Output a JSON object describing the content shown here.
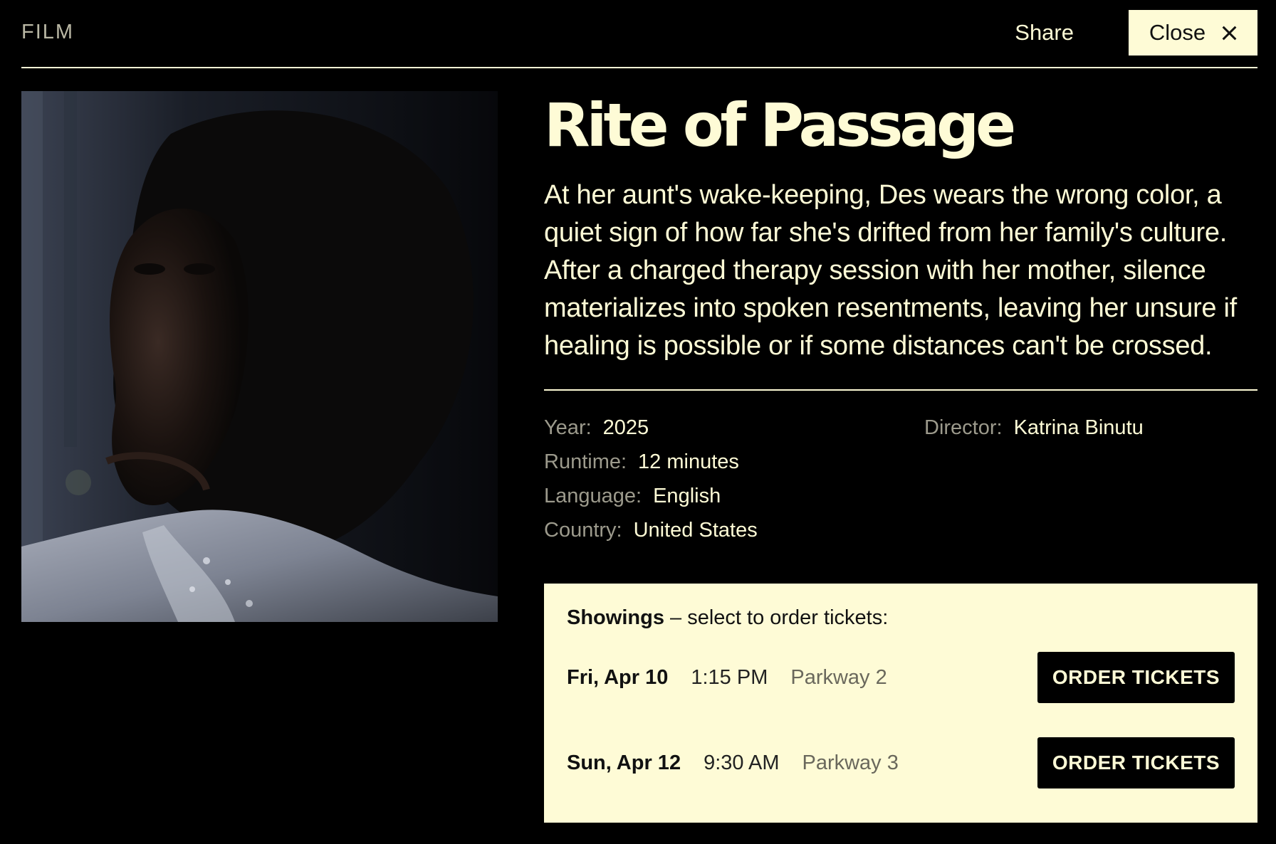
{
  "header": {
    "section_label": "FILM",
    "share_label": "Share",
    "close_label": "Close"
  },
  "film": {
    "title": "Rite of Passage",
    "synopsis": "At her aunt's wake-keeping, Des wears the wrong color, a quiet sign of how far she's drifted from her family's culture. After a charged therapy session with her mother, silence materializes into spoken resentments, leaving her unsure if healing is possible or if some distances can't be crossed.",
    "details": {
      "year_label": "Year:",
      "year": "2025",
      "runtime_label": "Runtime:",
      "runtime": "12 minutes",
      "language_label": "Language:",
      "language": "English",
      "country_label": "Country:",
      "country": "United States",
      "director_label": "Director:",
      "director": "Katrina Binutu"
    }
  },
  "showings": {
    "heading": "Showings",
    "subheading": " – select to order tickets:",
    "items": [
      {
        "date": "Fri, Apr 10",
        "time": "1:15 PM",
        "venue": "Parkway 2",
        "button": "ORDER TICKETS"
      },
      {
        "date": "Sun, Apr 12",
        "time": "9:30 AM",
        "venue": "Parkway 3",
        "button": "ORDER TICKETS"
      }
    ]
  },
  "colors": {
    "background": "#000000",
    "accent_cream": "#fefbd6",
    "muted_label": "#9c9a8c"
  }
}
